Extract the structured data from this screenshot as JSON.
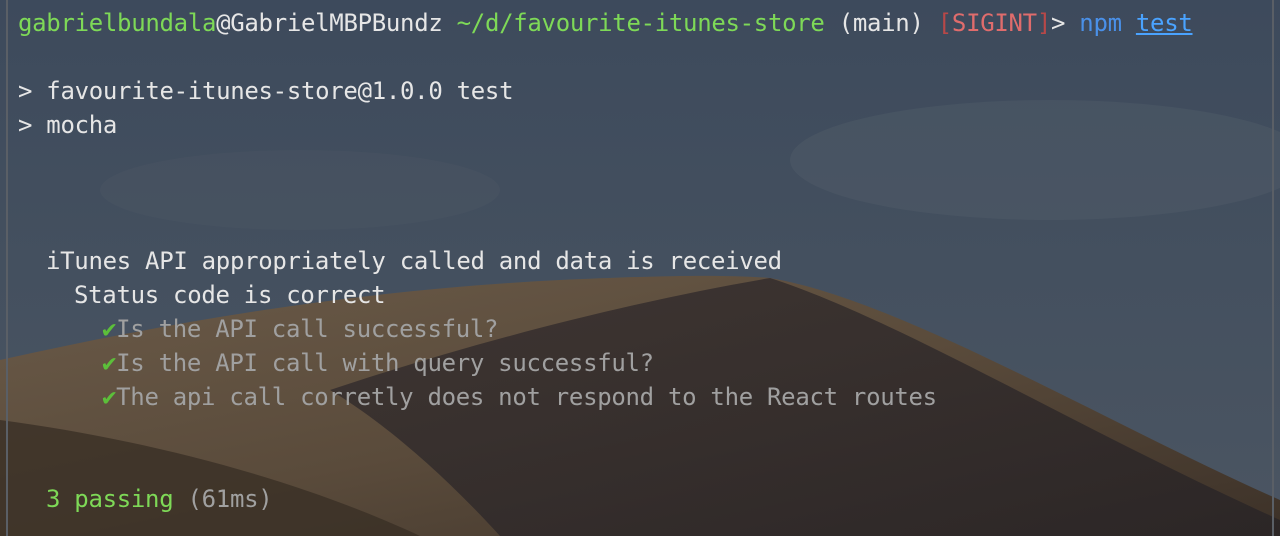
{
  "prompt": {
    "user_host": "gabrielbundala",
    "at": "@",
    "machine": "GabrielMBPBundz",
    "path": "~/d/favourite-itunes-store",
    "branch": "(main)",
    "signal_open": "[",
    "signal": "SIGINT",
    "signal_close": "]",
    "arrow": ">",
    "command": "npm",
    "argument": "test"
  },
  "script_header": {
    "line1": "> favourite-itunes-store@1.0.0 test",
    "line2": "> mocha"
  },
  "suite": {
    "title": "iTunes API appropriately called and data is received",
    "subsuite": "Status code is correct",
    "tests": [
      {
        "check": "✔",
        "name": "Is the API call successful?"
      },
      {
        "check": "✔",
        "name": "Is the API call with query successful?"
      },
      {
        "check": "✔",
        "name": "The api call corretly does not respond to the React routes"
      }
    ]
  },
  "summary": {
    "passing": "3 passing",
    "duration": "(61ms)"
  },
  "colors": {
    "prompt_green": "#7ed957",
    "signal_red": "#e06c6c",
    "command_blue": "#4a90e8",
    "check_green": "#5cbf3a",
    "test_gray": "#a0a0a0"
  }
}
